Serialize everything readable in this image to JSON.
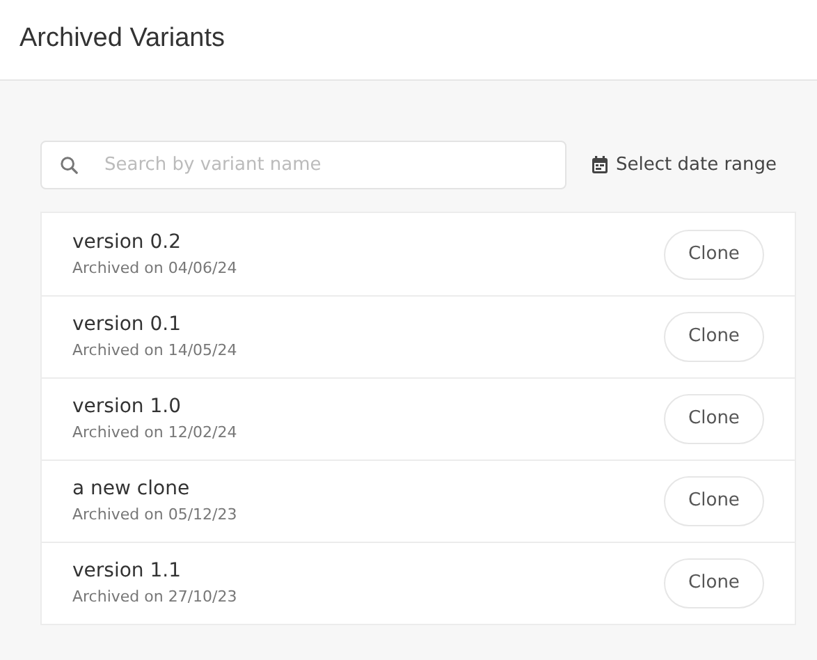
{
  "title": "Archived Variants",
  "search": {
    "placeholder": "Search by variant name"
  },
  "date_range": {
    "label": "Select date range"
  },
  "variants": [
    {
      "name": "version 0.2",
      "archived": "Archived on 04/06/24",
      "button": "Clone"
    },
    {
      "name": "version 0.1",
      "archived": "Archived on 14/05/24",
      "button": "Clone"
    },
    {
      "name": "version 1.0",
      "archived": "Archived on 12/02/24",
      "button": "Clone"
    },
    {
      "name": "a new clone",
      "archived": "Archived on 05/12/23",
      "button": "Clone"
    },
    {
      "name": "version 1.1",
      "archived": "Archived on 27/10/23",
      "button": "Clone"
    }
  ]
}
